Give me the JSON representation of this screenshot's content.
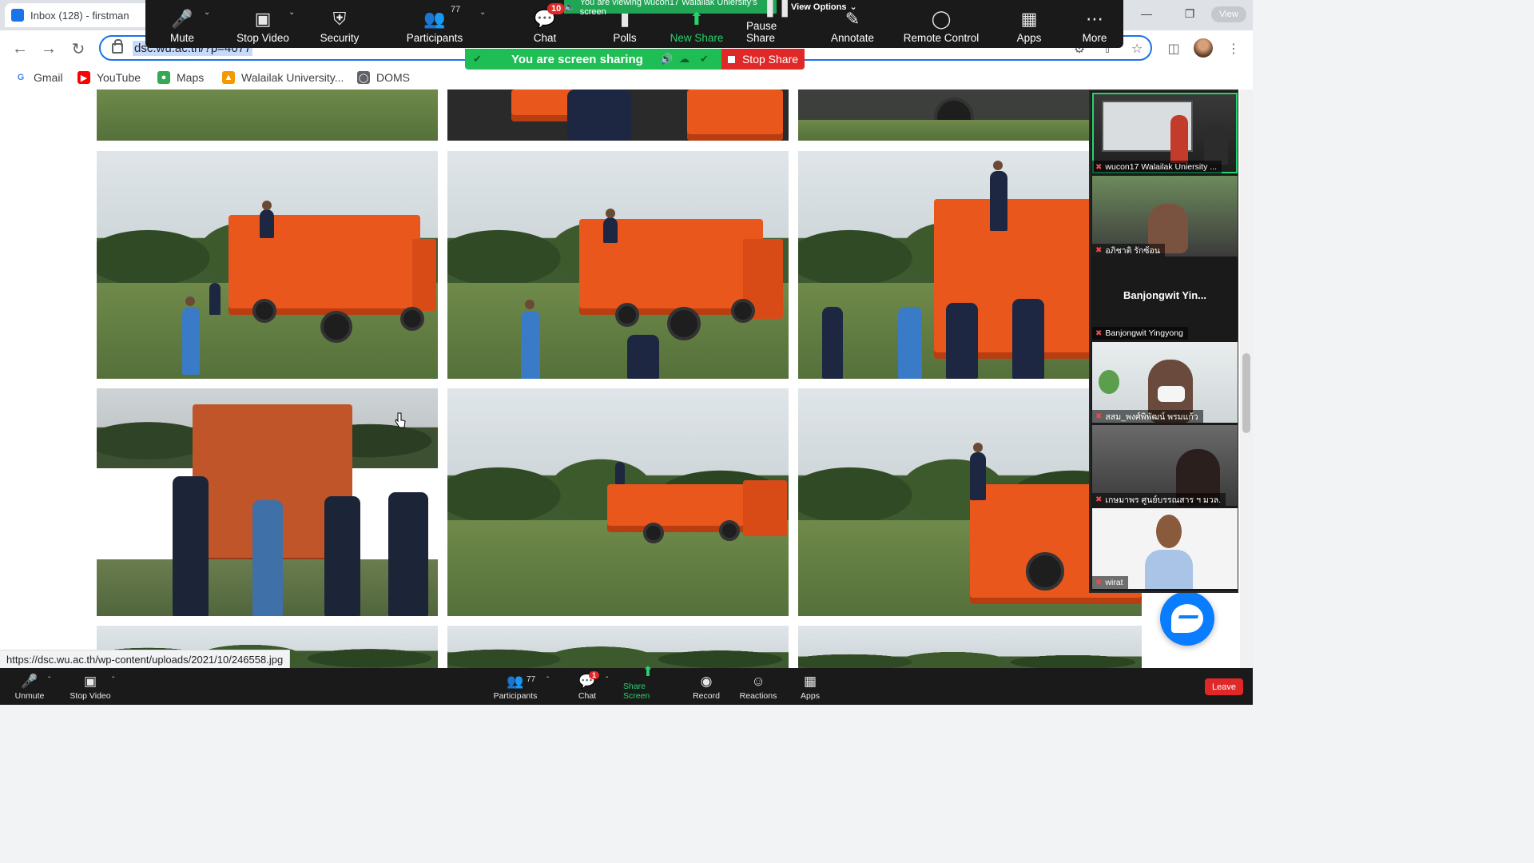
{
  "browser": {
    "tab_title": "Inbox (128) - firstman",
    "url": "dsc.wu.ac.th/?p=4077",
    "window_controls": [
      "—",
      "❐",
      "✕"
    ],
    "profile_chip": "View",
    "bookmarks": [
      {
        "label": "Gmail",
        "icon": "google-icon",
        "color": "#4285f4"
      },
      {
        "label": "YouTube",
        "icon": "youtube-icon",
        "color": "#ff0000"
      },
      {
        "label": "Maps",
        "icon": "maps-icon",
        "color": "#34a853"
      },
      {
        "label": "Walailak University...",
        "icon": "walailak-icon",
        "color": "#f29900"
      },
      {
        "label": "DOMS",
        "icon": "globe-icon",
        "color": "#5f6368"
      }
    ],
    "status_url": "https://dsc.wu.ac.th/wp-content/uploads/2021/10/246558.jpg"
  },
  "zoom_top": {
    "viewing_banner": "You are viewing wucon17 Walailak Uniersity's screen",
    "view_options": "View Options",
    "buttons": [
      {
        "label": "Mute",
        "icon": "microphone-icon"
      },
      {
        "label": "Stop Video",
        "icon": "video-camera-icon"
      },
      {
        "label": "Security",
        "icon": "shield-icon"
      },
      {
        "label": "Participants",
        "icon": "participants-icon",
        "count": "77"
      },
      {
        "label": "Chat",
        "icon": "chat-icon",
        "badge": "10"
      },
      {
        "label": "Polls",
        "icon": "polls-icon"
      },
      {
        "label": "New Share",
        "icon": "share-up-arrow-icon"
      },
      {
        "label": "Pause Share",
        "icon": "pause-icon"
      },
      {
        "label": "Annotate",
        "icon": "pencil-icon"
      },
      {
        "label": "Remote Control",
        "icon": "mouse-icon"
      },
      {
        "label": "Apps",
        "icon": "apps-icon"
      },
      {
        "label": "More",
        "icon": "more-dots-icon"
      }
    ],
    "sharing_text": "You are screen sharing",
    "stop_share": "Stop Share"
  },
  "video_tiles": [
    {
      "name": "wucon17 Walailak Uniersity ...",
      "type": "presentation"
    },
    {
      "name": "อภิชาติ รักซ้อน",
      "type": "person"
    },
    {
      "name": "Banjongwit Yingyong",
      "display": "Banjongwit  Yin...",
      "type": "no-video"
    },
    {
      "name": "สสม_พงศ์พิพัฒน์ พรมแก้ว",
      "type": "person-mask"
    },
    {
      "name": "เกษมาพร ศูนย์บรรณสาร ฯ มวล.",
      "type": "person-dim"
    },
    {
      "name": "wirat",
      "type": "person-shirt"
    }
  ],
  "zoom_bottom": {
    "buttons": [
      {
        "label": "Unmute",
        "icon": "microphone-muted-icon"
      },
      {
        "label": "Stop Video",
        "icon": "video-camera-icon"
      },
      {
        "label": "Participants",
        "icon": "participants-icon",
        "count": "77"
      },
      {
        "label": "Chat",
        "icon": "chat-icon",
        "badge": "1"
      },
      {
        "label": "Share Screen",
        "icon": "share-screen-icon"
      },
      {
        "label": "Record",
        "icon": "record-icon"
      },
      {
        "label": "Reactions",
        "icon": "reactions-icon"
      },
      {
        "label": "Apps",
        "icon": "apps-icon"
      }
    ],
    "leave": "Leave"
  },
  "colors": {
    "zoom_green": "#27d36b",
    "share_bar_green": "#1fbe55",
    "stop_red": "#e02828",
    "truck_orange": "#e9571c",
    "chrome_blue": "#1a73e8"
  }
}
